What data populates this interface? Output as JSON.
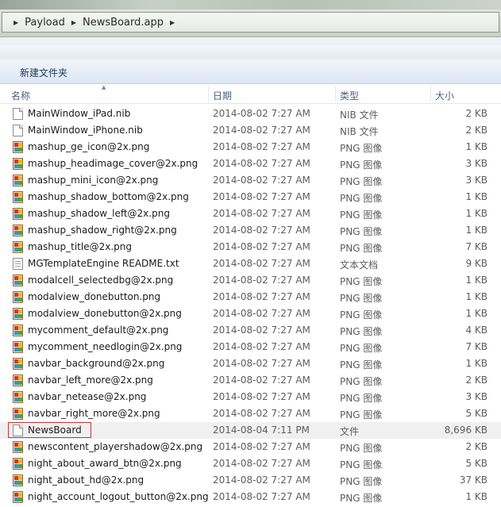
{
  "address_bar": {
    "crumbs": [
      "Payload",
      "NewsBoard.app"
    ]
  },
  "toolbar": {
    "new_folder_label": "新建文件夹"
  },
  "columns": {
    "name": "名称",
    "date": "日期",
    "type": "类型",
    "size": "大小"
  },
  "colors": {
    "selection_outline": "#cc3333",
    "header_text": "#4c607a",
    "command_text": "#1e395b"
  },
  "files": [
    {
      "name": "MainWindow_iPad.nib",
      "date": "2014-08-02 7:27 AM",
      "type": "NIB 文件",
      "size": "2 KB",
      "icon": "nib-file-icon"
    },
    {
      "name": "MainWindow_iPhone.nib",
      "date": "2014-08-02 7:27 AM",
      "type": "NIB 文件",
      "size": "2 KB",
      "icon": "nib-file-icon"
    },
    {
      "name": "mashup_ge_icon@2x.png",
      "date": "2014-08-02 7:27 AM",
      "type": "PNG 图像",
      "size": "1 KB",
      "icon": "png-image-icon"
    },
    {
      "name": "mashup_headimage_cover@2x.png",
      "date": "2014-08-02 7:27 AM",
      "type": "PNG 图像",
      "size": "3 KB",
      "icon": "png-image-icon"
    },
    {
      "name": "mashup_mini_icon@2x.png",
      "date": "2014-08-02 7:27 AM",
      "type": "PNG 图像",
      "size": "3 KB",
      "icon": "png-image-icon"
    },
    {
      "name": "mashup_shadow_bottom@2x.png",
      "date": "2014-08-02 7:27 AM",
      "type": "PNG 图像",
      "size": "1 KB",
      "icon": "png-image-icon"
    },
    {
      "name": "mashup_shadow_left@2x.png",
      "date": "2014-08-02 7:27 AM",
      "type": "PNG 图像",
      "size": "1 KB",
      "icon": "png-image-icon"
    },
    {
      "name": "mashup_shadow_right@2x.png",
      "date": "2014-08-02 7:27 AM",
      "type": "PNG 图像",
      "size": "1 KB",
      "icon": "png-image-icon"
    },
    {
      "name": "mashup_title@2x.png",
      "date": "2014-08-02 7:27 AM",
      "type": "PNG 图像",
      "size": "7 KB",
      "icon": "png-image-icon"
    },
    {
      "name": "MGTemplateEngine README.txt",
      "date": "2014-08-02 7:27 AM",
      "type": "文本文档",
      "size": "9 KB",
      "icon": "text-document-icon"
    },
    {
      "name": "modalcell_selectedbg@2x.png",
      "date": "2014-08-02 7:27 AM",
      "type": "PNG 图像",
      "size": "1 KB",
      "icon": "png-image-icon"
    },
    {
      "name": "modalview_donebutton.png",
      "date": "2014-08-02 7:27 AM",
      "type": "PNG 图像",
      "size": "1 KB",
      "icon": "png-image-icon"
    },
    {
      "name": "modalview_donebutton@2x.png",
      "date": "2014-08-02 7:27 AM",
      "type": "PNG 图像",
      "size": "1 KB",
      "icon": "png-image-icon"
    },
    {
      "name": "mycomment_default@2x.png",
      "date": "2014-08-02 7:27 AM",
      "type": "PNG 图像",
      "size": "4 KB",
      "icon": "png-image-icon"
    },
    {
      "name": "mycomment_needlogin@2x.png",
      "date": "2014-08-02 7:27 AM",
      "type": "PNG 图像",
      "size": "7 KB",
      "icon": "png-image-icon"
    },
    {
      "name": "navbar_background@2x.png",
      "date": "2014-08-02 7:27 AM",
      "type": "PNG 图像",
      "size": "1 KB",
      "icon": "png-image-icon"
    },
    {
      "name": "navbar_left_more@2x.png",
      "date": "2014-08-02 7:27 AM",
      "type": "PNG 图像",
      "size": "2 KB",
      "icon": "png-image-icon"
    },
    {
      "name": "navbar_netease@2x.png",
      "date": "2014-08-02 7:27 AM",
      "type": "PNG 图像",
      "size": "3 KB",
      "icon": "png-image-icon"
    },
    {
      "name": "navbar_right_more@2x.png",
      "date": "2014-08-02 7:27 AM",
      "type": "PNG 图像",
      "size": "5 KB",
      "icon": "png-image-icon"
    },
    {
      "name": "NewsBoard",
      "date": "2014-08-04 7:11 PM",
      "type": "文件",
      "size": "8,696 KB",
      "icon": "generic-file-icon",
      "selected": true
    },
    {
      "name": "newscontent_playershadow@2x.png",
      "date": "2014-08-02 7:27 AM",
      "type": "PNG 图像",
      "size": "2 KB",
      "icon": "png-image-icon"
    },
    {
      "name": "night_about_award_btn@2x.png",
      "date": "2014-08-02 7:27 AM",
      "type": "PNG 图像",
      "size": "5 KB",
      "icon": "png-image-icon"
    },
    {
      "name": "night_about_hd@2x.png",
      "date": "2014-08-02 7:27 AM",
      "type": "PNG 图像",
      "size": "37 KB",
      "icon": "png-image-icon"
    },
    {
      "name": "night_account_logout_button@2x.png",
      "date": "2014-08-02 7:27 AM",
      "type": "PNG 图像",
      "size": "1 KB",
      "icon": "png-image-icon"
    }
  ]
}
